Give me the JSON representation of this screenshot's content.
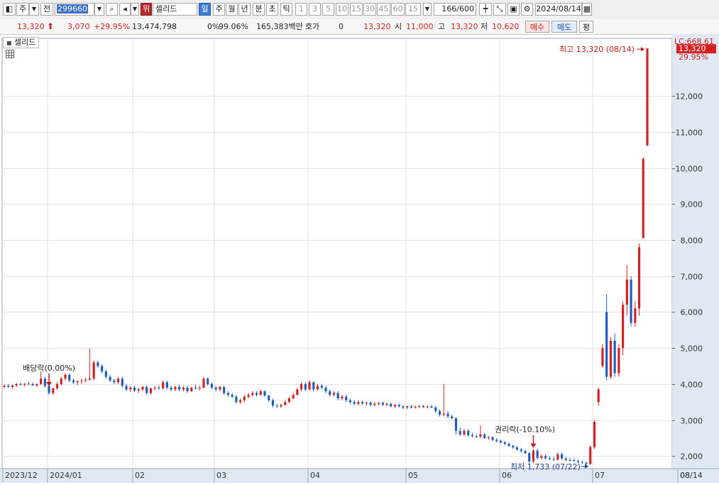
{
  "toolbar": {
    "market_type": "주",
    "market_scope": "전",
    "code": "299660",
    "tag": "위",
    "name": "셀리드",
    "periods": [
      "일",
      "주",
      "월",
      "년",
      "분",
      "초",
      "틱"
    ],
    "intervals": [
      "1",
      "3",
      "5",
      "10",
      "15",
      "30",
      "45",
      "60",
      "15"
    ],
    "count_value": "166",
    "count_max": "/600",
    "date": "2024/08/14"
  },
  "info": {
    "price": "13,320",
    "change": "3,070",
    "change_pct": "+29.95%",
    "volume": "13,474,798",
    "turnover_pct": "0%",
    "strength": "99.06%",
    "amount": "165,383백만",
    "bid_label": "호가",
    "bid_value": "0",
    "bid_price": "13,320",
    "open_label": "시",
    "open_value": "11,000",
    "high_label": "고",
    "high_value": "13,320",
    "low_label": "저",
    "low_value": "10,620",
    "buy_label": "매수",
    "sell_label": "매도",
    "avg_label": "평"
  },
  "chart_data": {
    "type": "candlestick",
    "legend": "셀리드",
    "yticks": [
      "2,000",
      "3,000",
      "4,000",
      "5,000",
      "6,000",
      "7,000",
      "8,000",
      "9,000",
      "10,000",
      "11,000",
      "12,000"
    ],
    "ylim": [
      1650,
      13600
    ],
    "xticks": [
      "2023/12",
      "2024/01",
      "02",
      "03",
      "04",
      "05",
      "06",
      "07",
      "08",
      "08/14"
    ],
    "lc_label": "LC:668.61",
    "last_price": "13,320",
    "last_pct": "29.95%",
    "annotations": {
      "high": "최고 13,320 (08/14)",
      "low": "최저 1,733 (07/22)",
      "dividend": "배당락(0.00%)",
      "rights": "권리락(-10.10%)"
    },
    "colors": {
      "up": "#d42020",
      "down": "#1f5cc2",
      "grid": "#e2e2e2",
      "axis_bg": "#dfe8f3"
    },
    "candles": [
      [
        3920,
        3990,
        3880,
        3950
      ],
      [
        3950,
        4000,
        3900,
        3920
      ],
      [
        3920,
        3980,
        3870,
        3960
      ],
      [
        3960,
        4030,
        3920,
        4000
      ],
      [
        4000,
        4050,
        3960,
        3980
      ],
      [
        3980,
        4030,
        3930,
        4010
      ],
      [
        4010,
        4060,
        3970,
        4000
      ],
      [
        4000,
        4040,
        3950,
        3960
      ],
      [
        3960,
        4020,
        3920,
        4000
      ],
      [
        4000,
        4350,
        3980,
        4150
      ],
      [
        4150,
        4200,
        3900,
        3950
      ],
      [
        3950,
        4000,
        3700,
        3750
      ],
      [
        3750,
        3900,
        3700,
        3880
      ],
      [
        3880,
        4050,
        3850,
        4000
      ],
      [
        4000,
        4200,
        3970,
        4150
      ],
      [
        4150,
        4300,
        4100,
        4260
      ],
      [
        4260,
        4300,
        4050,
        4100
      ],
      [
        4100,
        4150,
        4000,
        4050
      ],
      [
        4050,
        4100,
        3980,
        4080
      ],
      [
        4080,
        4150,
        4000,
        4100
      ],
      [
        4100,
        4180,
        4050,
        4120
      ],
      [
        4120,
        4980,
        4100,
        4150
      ],
      [
        4150,
        4650,
        4100,
        4600
      ],
      [
        4600,
        4650,
        4450,
        4500
      ],
      [
        4500,
        4550,
        4300,
        4350
      ],
      [
        4350,
        4400,
        4150,
        4200
      ],
      [
        4200,
        4250,
        4050,
        4100
      ],
      [
        4100,
        4150,
        4000,
        4050
      ],
      [
        4050,
        4200,
        4000,
        4150
      ],
      [
        4150,
        4200,
        3900,
        3950
      ],
      [
        3950,
        4000,
        3800,
        3850
      ],
      [
        3850,
        3950,
        3780,
        3900
      ],
      [
        3900,
        3950,
        3780,
        3820
      ],
      [
        3820,
        3900,
        3750,
        3850
      ],
      [
        3850,
        3950,
        3800,
        3920
      ],
      [
        3920,
        3960,
        3700,
        3750
      ],
      [
        3750,
        3900,
        3700,
        3880
      ],
      [
        3880,
        3950,
        3820,
        3900
      ],
      [
        3900,
        3960,
        3850,
        3880
      ],
      [
        3880,
        4100,
        3850,
        4050
      ],
      [
        4050,
        4100,
        3850,
        3900
      ],
      [
        3900,
        3950,
        3800,
        3850
      ],
      [
        3850,
        3950,
        3800,
        3920
      ],
      [
        3920,
        3980,
        3800,
        3850
      ],
      [
        3850,
        3950,
        3800,
        3900
      ],
      [
        3900,
        3950,
        3750,
        3800
      ],
      [
        3800,
        3920,
        3780,
        3900
      ],
      [
        3900,
        3980,
        3850,
        3880
      ],
      [
        3880,
        3950,
        3820,
        3900
      ],
      [
        3900,
        4200,
        3880,
        4150
      ],
      [
        4150,
        4180,
        3950,
        4000
      ],
      [
        4000,
        4050,
        3850,
        3900
      ],
      [
        3900,
        3950,
        3800,
        3850
      ],
      [
        3850,
        3950,
        3800,
        3920
      ],
      [
        3920,
        3950,
        3700,
        3750
      ],
      [
        3750,
        3800,
        3650,
        3700
      ],
      [
        3700,
        3750,
        3600,
        3650
      ],
      [
        3650,
        3700,
        3450,
        3500
      ],
      [
        3500,
        3600,
        3450,
        3550
      ],
      [
        3550,
        3700,
        3500,
        3650
      ],
      [
        3650,
        3750,
        3600,
        3700
      ],
      [
        3700,
        3800,
        3650,
        3750
      ],
      [
        3750,
        3800,
        3650,
        3700
      ],
      [
        3700,
        3850,
        3680,
        3800
      ],
      [
        3800,
        3820,
        3650,
        3680
      ],
      [
        3680,
        3700,
        3500,
        3550
      ],
      [
        3550,
        3600,
        3350,
        3400
      ],
      [
        3400,
        3450,
        3330,
        3380
      ],
      [
        3380,
        3450,
        3340,
        3420
      ],
      [
        3420,
        3550,
        3400,
        3500
      ],
      [
        3500,
        3650,
        3480,
        3600
      ],
      [
        3600,
        3750,
        3580,
        3700
      ],
      [
        3700,
        3900,
        3680,
        3850
      ],
      [
        3850,
        4050,
        3800,
        4000
      ],
      [
        4000,
        4050,
        3800,
        3850
      ],
      [
        3850,
        4100,
        3830,
        4050
      ],
      [
        4050,
        4080,
        3800,
        3850
      ],
      [
        3850,
        4000,
        3820,
        3950
      ],
      [
        3950,
        4000,
        3850,
        3900
      ],
      [
        3900,
        3950,
        3750,
        3800
      ],
      [
        3800,
        3850,
        3650,
        3700
      ],
      [
        3700,
        3800,
        3650,
        3750
      ],
      [
        3750,
        3800,
        3550,
        3600
      ],
      [
        3600,
        3700,
        3550,
        3650
      ],
      [
        3650,
        3700,
        3500,
        3550
      ],
      [
        3550,
        3600,
        3450,
        3500
      ],
      [
        3500,
        3560,
        3420,
        3450
      ],
      [
        3450,
        3550,
        3400,
        3500
      ],
      [
        3500,
        3540,
        3420,
        3460
      ],
      [
        3460,
        3520,
        3400,
        3480
      ],
      [
        3480,
        3520,
        3380,
        3420
      ],
      [
        3420,
        3500,
        3380,
        3450
      ],
      [
        3450,
        3500,
        3400,
        3480
      ],
      [
        3480,
        3520,
        3400,
        3420
      ],
      [
        3420,
        3480,
        3380,
        3450
      ],
      [
        3450,
        3480,
        3350,
        3380
      ],
      [
        3380,
        3450,
        3330,
        3420
      ],
      [
        3420,
        3460,
        3350,
        3380
      ],
      [
        3380,
        3420,
        3300,
        3350
      ],
      [
        3350,
        3400,
        3300,
        3380
      ],
      [
        3380,
        3420,
        3320,
        3350
      ],
      [
        3350,
        3400,
        3320,
        3370
      ],
      [
        3370,
        3420,
        3330,
        3390
      ],
      [
        3390,
        3420,
        3330,
        3360
      ],
      [
        3360,
        3400,
        3320,
        3380
      ],
      [
        3380,
        3420,
        3330,
        3350
      ],
      [
        3350,
        3400,
        3200,
        3250
      ],
      [
        3250,
        3300,
        3100,
        3150
      ],
      [
        3150,
        4000,
        3100,
        3180
      ],
      [
        3180,
        3250,
        3050,
        3100
      ],
      [
        3100,
        3150,
        3020,
        3050
      ],
      [
        3050,
        3080,
        2600,
        2700
      ],
      [
        2700,
        2800,
        2560,
        2600
      ],
      [
        2600,
        2750,
        2550,
        2700
      ],
      [
        2700,
        2750,
        2540,
        2580
      ],
      [
        2580,
        2650,
        2520,
        2550
      ],
      [
        2550,
        2600,
        2500,
        2540
      ],
      [
        2540,
        2850,
        2500,
        2600
      ],
      [
        2600,
        2640,
        2480,
        2500
      ],
      [
        2500,
        2560,
        2450,
        2520
      ],
      [
        2520,
        2560,
        2420,
        2450
      ],
      [
        2450,
        2500,
        2380,
        2420
      ],
      [
        2420,
        2460,
        2350,
        2380
      ],
      [
        2380,
        2420,
        2300,
        2340
      ],
      [
        2340,
        2380,
        2250,
        2280
      ],
      [
        2280,
        2320,
        2200,
        2240
      ],
      [
        2240,
        2280,
        2150,
        2180
      ],
      [
        2180,
        2220,
        2100,
        2140
      ],
      [
        2140,
        2180,
        2050,
        2080
      ],
      [
        2080,
        2120,
        1800,
        1850
      ],
      [
        1850,
        2200,
        1800,
        2150
      ],
      [
        2150,
        2200,
        1900,
        1950
      ],
      [
        1950,
        2050,
        1900,
        2000
      ],
      [
        2000,
        2050,
        1900,
        1940
      ],
      [
        1940,
        2000,
        1880,
        1920
      ],
      [
        1920,
        1980,
        1870,
        1900
      ],
      [
        1900,
        2100,
        1880,
        2050
      ],
      [
        2050,
        2100,
        1900,
        1930
      ],
      [
        1930,
        1980,
        1860,
        1890
      ],
      [
        1890,
        1950,
        1850,
        1880
      ],
      [
        1880,
        1940,
        1840,
        1860
      ],
      [
        1860,
        1900,
        1800,
        1830
      ],
      [
        1830,
        1880,
        1780,
        1810
      ],
      [
        1810,
        1850,
        1733,
        1780
      ],
      [
        1780,
        2300,
        1760,
        2250
      ],
      [
        2250,
        3000,
        2200,
        2950
      ],
      [
        3500,
        3900,
        3400,
        3850
      ],
      [
        4500,
        5100,
        4450,
        5000
      ],
      [
        6000,
        6500,
        4100,
        4200
      ],
      [
        4200,
        5300,
        4150,
        5200
      ],
      [
        5200,
        5400,
        4200,
        4300
      ],
      [
        4300,
        5100,
        4200,
        5000
      ],
      [
        5000,
        6300,
        4800,
        6200
      ],
      [
        6200,
        7300,
        5900,
        6900
      ],
      [
        6900,
        7000,
        5600,
        5700
      ],
      [
        5700,
        6300,
        5600,
        6100
      ],
      [
        6100,
        7900,
        5900,
        7800
      ],
      [
        8050,
        10300,
        8050,
        10250
      ],
      [
        10620,
        13320,
        10620,
        13320
      ]
    ]
  }
}
